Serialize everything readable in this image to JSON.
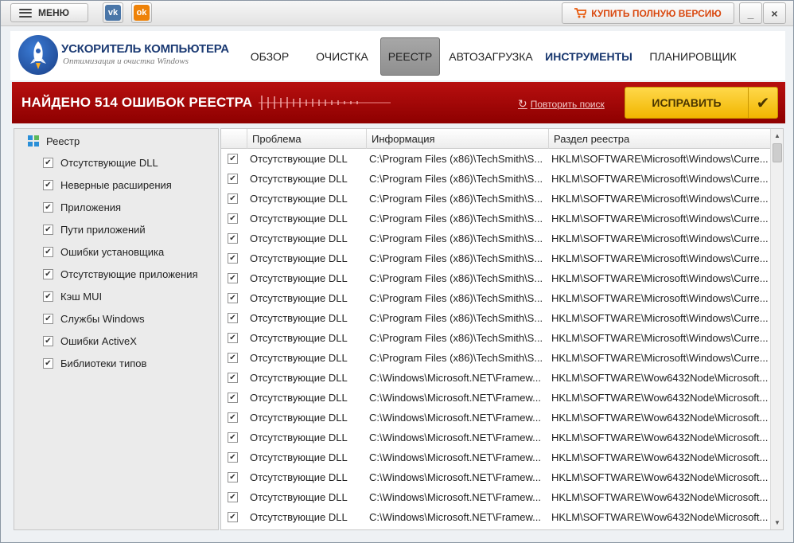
{
  "titlebar": {
    "menu_label": "МЕНЮ",
    "vk_label": "vk",
    "ok_label": "ok",
    "buy_label": "КУПИТЬ ПОЛНУЮ ВЕРСИЮ",
    "minimize_glyph": "_",
    "close_glyph": "×"
  },
  "header": {
    "app_title": "УСКОРИТЕЛЬ КОМПЬЮТЕРА",
    "app_subtitle": "Оптимизация и очистка Windows",
    "nav": {
      "overview": "ОБЗОР",
      "cleanup": "ОЧИСТКА",
      "registry": "РЕЕСТР",
      "autorun": "АВТОЗАГРУЗКА",
      "tools": "ИНСТРУМЕНТЫ",
      "scheduler": "ПЛАНИРОВЩИК"
    }
  },
  "banner": {
    "title": "НАЙДЕНО 514 ОШИБОК РЕЕСТРА",
    "retry_label": "Повторить поиск",
    "fix_label": "ИСПРАВИТЬ"
  },
  "colors": {
    "banner_red": "#a30606",
    "fix_yellow": "#f7c719",
    "nav_active": "#9b9b9b",
    "brand_blue": "#1b3a73"
  },
  "sidebar": {
    "root_label": "Реестр",
    "items": [
      {
        "label": "Отсутствующие DLL",
        "checked": true
      },
      {
        "label": "Неверные расширения",
        "checked": true
      },
      {
        "label": "Приложения",
        "checked": true
      },
      {
        "label": "Пути приложений",
        "checked": true
      },
      {
        "label": "Ошибки установщика",
        "checked": true
      },
      {
        "label": "Отсутствующие приложения",
        "checked": true
      },
      {
        "label": "Кэш MUI",
        "checked": true
      },
      {
        "label": "Службы Windows",
        "checked": true
      },
      {
        "label": "Ошибки ActiveX",
        "checked": true
      },
      {
        "label": "Библиотеки типов",
        "checked": true
      }
    ]
  },
  "table": {
    "headers": {
      "problem": "Проблема",
      "info": "Информация",
      "section": "Раздел реестра"
    },
    "rows": [
      {
        "problem": "Отсутствующие DLL",
        "info": "C:\\Program Files (x86)\\TechSmith\\S...",
        "section": "HKLM\\SOFTWARE\\Microsoft\\Windows\\Curre..."
      },
      {
        "problem": "Отсутствующие DLL",
        "info": "C:\\Program Files (x86)\\TechSmith\\S...",
        "section": "HKLM\\SOFTWARE\\Microsoft\\Windows\\Curre..."
      },
      {
        "problem": "Отсутствующие DLL",
        "info": "C:\\Program Files (x86)\\TechSmith\\S...",
        "section": "HKLM\\SOFTWARE\\Microsoft\\Windows\\Curre..."
      },
      {
        "problem": "Отсутствующие DLL",
        "info": "C:\\Program Files (x86)\\TechSmith\\S...",
        "section": "HKLM\\SOFTWARE\\Microsoft\\Windows\\Curre..."
      },
      {
        "problem": "Отсутствующие DLL",
        "info": "C:\\Program Files (x86)\\TechSmith\\S...",
        "section": "HKLM\\SOFTWARE\\Microsoft\\Windows\\Curre..."
      },
      {
        "problem": "Отсутствующие DLL",
        "info": "C:\\Program Files (x86)\\TechSmith\\S...",
        "section": "HKLM\\SOFTWARE\\Microsoft\\Windows\\Curre..."
      },
      {
        "problem": "Отсутствующие DLL",
        "info": "C:\\Program Files (x86)\\TechSmith\\S...",
        "section": "HKLM\\SOFTWARE\\Microsoft\\Windows\\Curre..."
      },
      {
        "problem": "Отсутствующие DLL",
        "info": "C:\\Program Files (x86)\\TechSmith\\S...",
        "section": "HKLM\\SOFTWARE\\Microsoft\\Windows\\Curre..."
      },
      {
        "problem": "Отсутствующие DLL",
        "info": "C:\\Program Files (x86)\\TechSmith\\S...",
        "section": "HKLM\\SOFTWARE\\Microsoft\\Windows\\Curre..."
      },
      {
        "problem": "Отсутствующие DLL",
        "info": "C:\\Program Files (x86)\\TechSmith\\S...",
        "section": "HKLM\\SOFTWARE\\Microsoft\\Windows\\Curre..."
      },
      {
        "problem": "Отсутствующие DLL",
        "info": "C:\\Program Files (x86)\\TechSmith\\S...",
        "section": "HKLM\\SOFTWARE\\Microsoft\\Windows\\Curre..."
      },
      {
        "problem": "Отсутствующие DLL",
        "info": "C:\\Windows\\Microsoft.NET\\Framew...",
        "section": "HKLM\\SOFTWARE\\Wow6432Node\\Microsoft..."
      },
      {
        "problem": "Отсутствующие DLL",
        "info": "C:\\Windows\\Microsoft.NET\\Framew...",
        "section": "HKLM\\SOFTWARE\\Wow6432Node\\Microsoft..."
      },
      {
        "problem": "Отсутствующие DLL",
        "info": "C:\\Windows\\Microsoft.NET\\Framew...",
        "section": "HKLM\\SOFTWARE\\Wow6432Node\\Microsoft..."
      },
      {
        "problem": "Отсутствующие DLL",
        "info": "C:\\Windows\\Microsoft.NET\\Framew...",
        "section": "HKLM\\SOFTWARE\\Wow6432Node\\Microsoft..."
      },
      {
        "problem": "Отсутствующие DLL",
        "info": "C:\\Windows\\Microsoft.NET\\Framew...",
        "section": "HKLM\\SOFTWARE\\Wow6432Node\\Microsoft..."
      },
      {
        "problem": "Отсутствующие DLL",
        "info": "C:\\Windows\\Microsoft.NET\\Framew...",
        "section": "HKLM\\SOFTWARE\\Wow6432Node\\Microsoft..."
      },
      {
        "problem": "Отсутствующие DLL",
        "info": "C:\\Windows\\Microsoft.NET\\Framew...",
        "section": "HKLM\\SOFTWARE\\Wow6432Node\\Microsoft..."
      },
      {
        "problem": "Отсутствующие DLL",
        "info": "C:\\Windows\\Microsoft.NET\\Framew...",
        "section": "HKLM\\SOFTWARE\\Wow6432Node\\Microsoft..."
      }
    ]
  }
}
